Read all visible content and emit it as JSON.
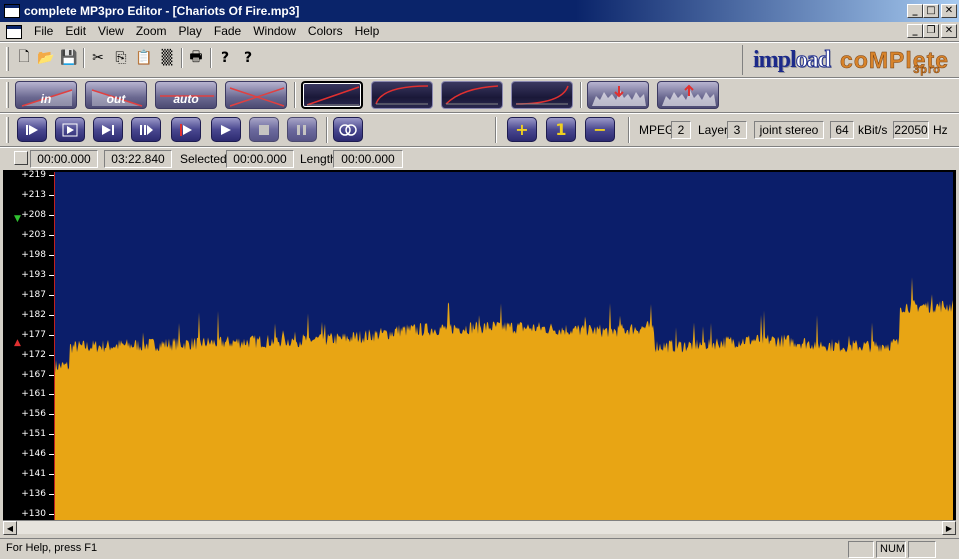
{
  "window": {
    "title": "complete MP3pro Editor - [Chariots Of Fire.mp3]",
    "controls": {
      "minimize": "_",
      "maximize": "□",
      "close": "✕",
      "restore": "❐"
    }
  },
  "menu": [
    "File",
    "Edit",
    "View",
    "Zoom",
    "Play",
    "Fade",
    "Window",
    "Colors",
    "Help"
  ],
  "toolbar": {
    "icons": [
      "new-icon",
      "open-icon",
      "save-icon",
      "cut-icon",
      "copy-icon",
      "paste-icon",
      "mix-icon",
      "print-icon",
      "help-icon",
      "context-help-icon"
    ],
    "glyphs": [
      "🗋",
      "📂",
      "💾",
      "✂",
      "⎘",
      "📋",
      "▒",
      "🖶",
      "?",
      "?"
    ]
  },
  "logo": {
    "part1": "impl",
    "part2": "oad",
    "part3": "coMPlete",
    "part4": "3pro"
  },
  "fades": {
    "fade_in": "in",
    "fade_out": "out",
    "fade_auto": "auto",
    "crossfade": ""
  },
  "playback": {
    "plus": "+",
    "one": "1",
    "minus": "−"
  },
  "format": {
    "mpeg_label": "MPEG",
    "mpeg_value": "2",
    "layer_label": "Layer",
    "layer_value": "3",
    "mode": "joint stereo",
    "bitrate_value": "64",
    "bitrate_unit": "kBit/s",
    "samplerate_value": "22050",
    "samplerate_unit": "Hz"
  },
  "time": {
    "position": "00:00.000",
    "duration": "03:22.840",
    "selected_label": "Selected",
    "selected_value": "00:00.000",
    "length_label": "Length",
    "length_value": "00:00.000"
  },
  "ruler": [
    "+219",
    "+213",
    "+208",
    "+203",
    "+198",
    "+193",
    "+187",
    "+182",
    "+177",
    "+172",
    "+167",
    "+161",
    "+156",
    "+151",
    "+146",
    "+141",
    "+136",
    "+130"
  ],
  "colors": {
    "wave_bg": "#0b1e6a",
    "wave_fill": "#e8a514",
    "title_bar": "#0a246a"
  },
  "status": {
    "help": "For Help, press F1",
    "num": "NUM"
  }
}
